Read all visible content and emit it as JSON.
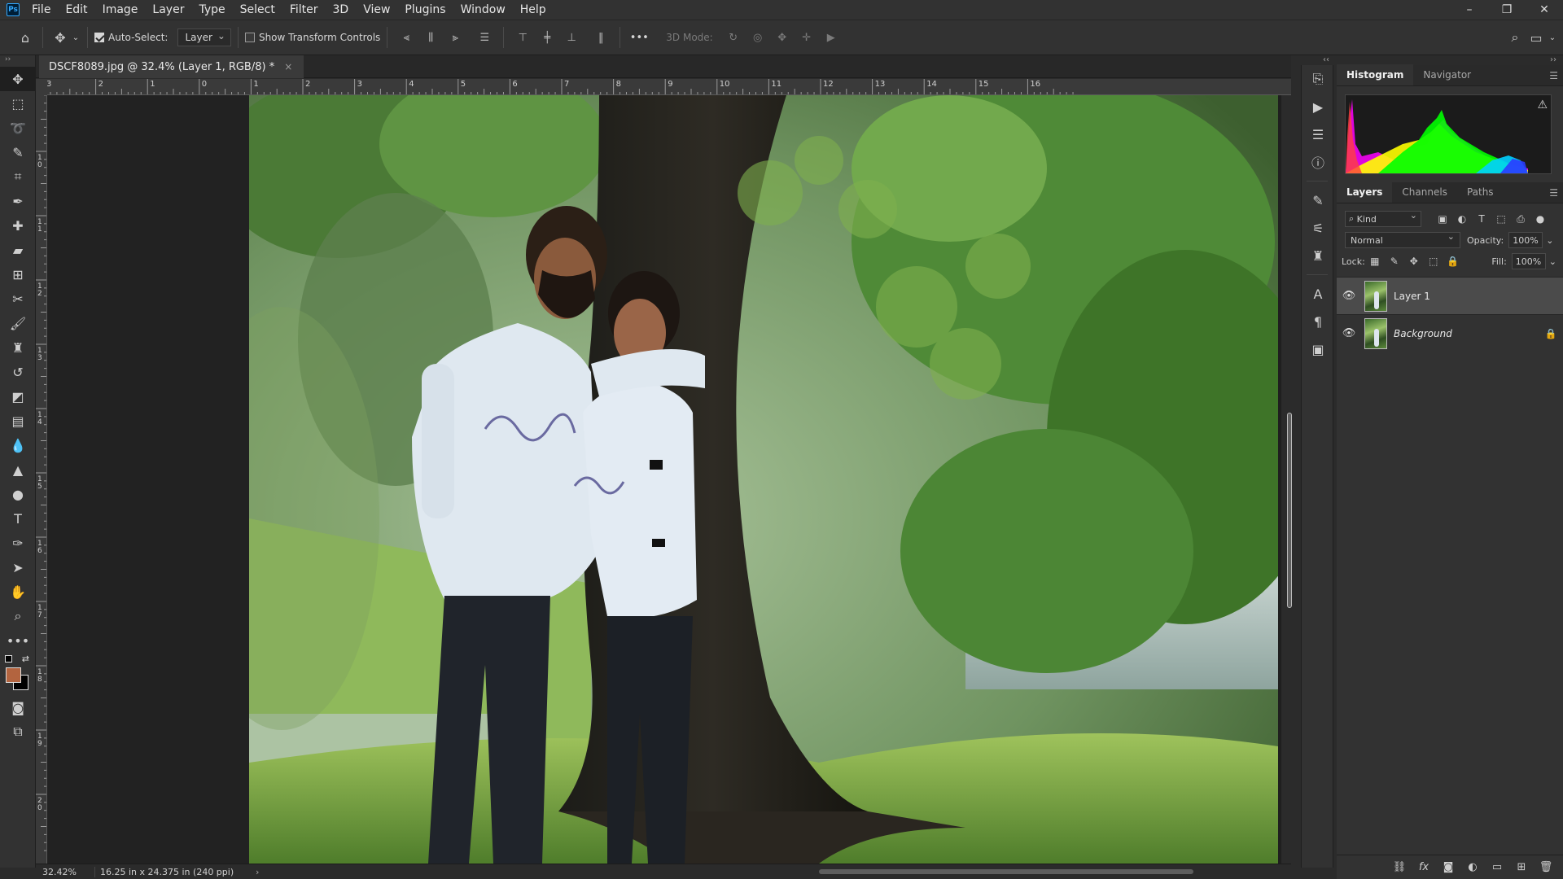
{
  "app": {
    "logo": "Ps",
    "menu": [
      "File",
      "Edit",
      "Image",
      "Layer",
      "Type",
      "Select",
      "Filter",
      "3D",
      "View",
      "Plugins",
      "Window",
      "Help"
    ],
    "window_controls": [
      "–",
      "❐",
      "✕"
    ]
  },
  "options_bar": {
    "auto_select_label": "Auto-Select:",
    "auto_select_checked": true,
    "auto_select_target": "Layer",
    "show_transform_label": "Show Transform Controls",
    "show_transform_checked": false,
    "more_label": "•••",
    "mode3d_label": "3D Mode:"
  },
  "document": {
    "tab_title": "DSCF8089.jpg @ 32.4% (Layer 1, RGB/8) *",
    "close_glyph": "×",
    "zoom": "32.42%",
    "doc_info": "16.25 in x 24.375 in (240 ppi)",
    "status_arrow": "›"
  },
  "rulers": {
    "horizontal": [
      "3",
      "2",
      "1",
      "0",
      "1",
      "2",
      "3",
      "4",
      "5",
      "6",
      "7",
      "8",
      "9",
      "10",
      "11",
      "12",
      "13",
      "14",
      "15",
      "16"
    ],
    "vertical": [
      "9",
      "1\n0",
      "1\n1",
      "1\n2",
      "1\n3",
      "1\n4",
      "1\n5",
      "1\n6",
      "1\n7",
      "1\n8",
      "1\n9",
      "2\n0"
    ]
  },
  "toolbar": {
    "tools": [
      {
        "name": "move-tool",
        "glyph": "✥",
        "active": true
      },
      {
        "name": "marquee-tool",
        "glyph": "⬚"
      },
      {
        "name": "lasso-tool",
        "glyph": "➰"
      },
      {
        "name": "quick-select-tool",
        "glyph": "✎"
      },
      {
        "name": "crop-tool",
        "glyph": "⌗"
      },
      {
        "name": "eyedropper-tool",
        "glyph": "✒"
      },
      {
        "name": "healing-tool",
        "glyph": "✚"
      },
      {
        "name": "ruler-tool",
        "glyph": "▰"
      },
      {
        "name": "frame-tool",
        "glyph": "⊞"
      },
      {
        "name": "patch-tool",
        "glyph": "✂"
      },
      {
        "name": "brush-tool",
        "glyph": "🖌"
      },
      {
        "name": "stamp-tool",
        "glyph": "♜"
      },
      {
        "name": "history-brush-tool",
        "glyph": "↺"
      },
      {
        "name": "eraser-tool",
        "glyph": "◩"
      },
      {
        "name": "gradient-tool",
        "glyph": "▤"
      },
      {
        "name": "blur-tool",
        "glyph": "💧"
      },
      {
        "name": "sharpen-tool",
        "glyph": "▲"
      },
      {
        "name": "dodge-tool",
        "glyph": "●"
      },
      {
        "name": "type-tool",
        "glyph": "T"
      },
      {
        "name": "pen-tool",
        "glyph": "✑"
      },
      {
        "name": "path-select-tool",
        "glyph": "➤"
      },
      {
        "name": "hand-tool",
        "glyph": "✋"
      },
      {
        "name": "zoom-tool",
        "glyph": "⌕"
      },
      {
        "name": "more-tools",
        "glyph": "•••"
      }
    ],
    "bottom_tools": [
      {
        "name": "quick-mask-tool",
        "glyph": "◙"
      },
      {
        "name": "screen-mode-tool",
        "glyph": "⧉"
      }
    ],
    "fg_color": "#b3643f",
    "bg_color": "#000000"
  },
  "right_icons": [
    {
      "name": "history-icon",
      "glyph": "⎘"
    },
    {
      "name": "actions-icon",
      "glyph": "▶"
    },
    {
      "name": "adjustments-icon",
      "glyph": "☰"
    },
    {
      "name": "info-icon",
      "glyph": "ⓘ"
    },
    {
      "name": "brushes-icon",
      "glyph": "✎"
    },
    {
      "name": "brush-settings-icon",
      "glyph": "⚟"
    },
    {
      "name": "clone-source-icon",
      "glyph": "♜"
    },
    {
      "name": "character-icon",
      "glyph": "A"
    },
    {
      "name": "paragraph-icon",
      "glyph": "¶"
    },
    {
      "name": "glyphs-icon",
      "glyph": "▣"
    }
  ],
  "histogram_panel": {
    "tabs": [
      "Histogram",
      "Navigator"
    ],
    "active_tab": "Histogram",
    "warning_glyph": "⚠"
  },
  "layers_panel": {
    "tabs": [
      "Layers",
      "Channels",
      "Paths"
    ],
    "active_tab": "Layers",
    "kind_label": "Kind",
    "blend_mode": "Normal",
    "opacity_label": "Opacity:",
    "opacity_value": "100%",
    "lock_label": "Lock:",
    "fill_label": "Fill:",
    "fill_value": "100%",
    "layers": [
      {
        "name": "Layer 1",
        "selected": true,
        "locked": false,
        "italic": false
      },
      {
        "name": "Background",
        "selected": false,
        "locked": true,
        "italic": true
      }
    ]
  },
  "colors": {
    "app_bg": "#2b2b2b",
    "panel_bg": "#323232",
    "accent": "#31a8ff"
  }
}
